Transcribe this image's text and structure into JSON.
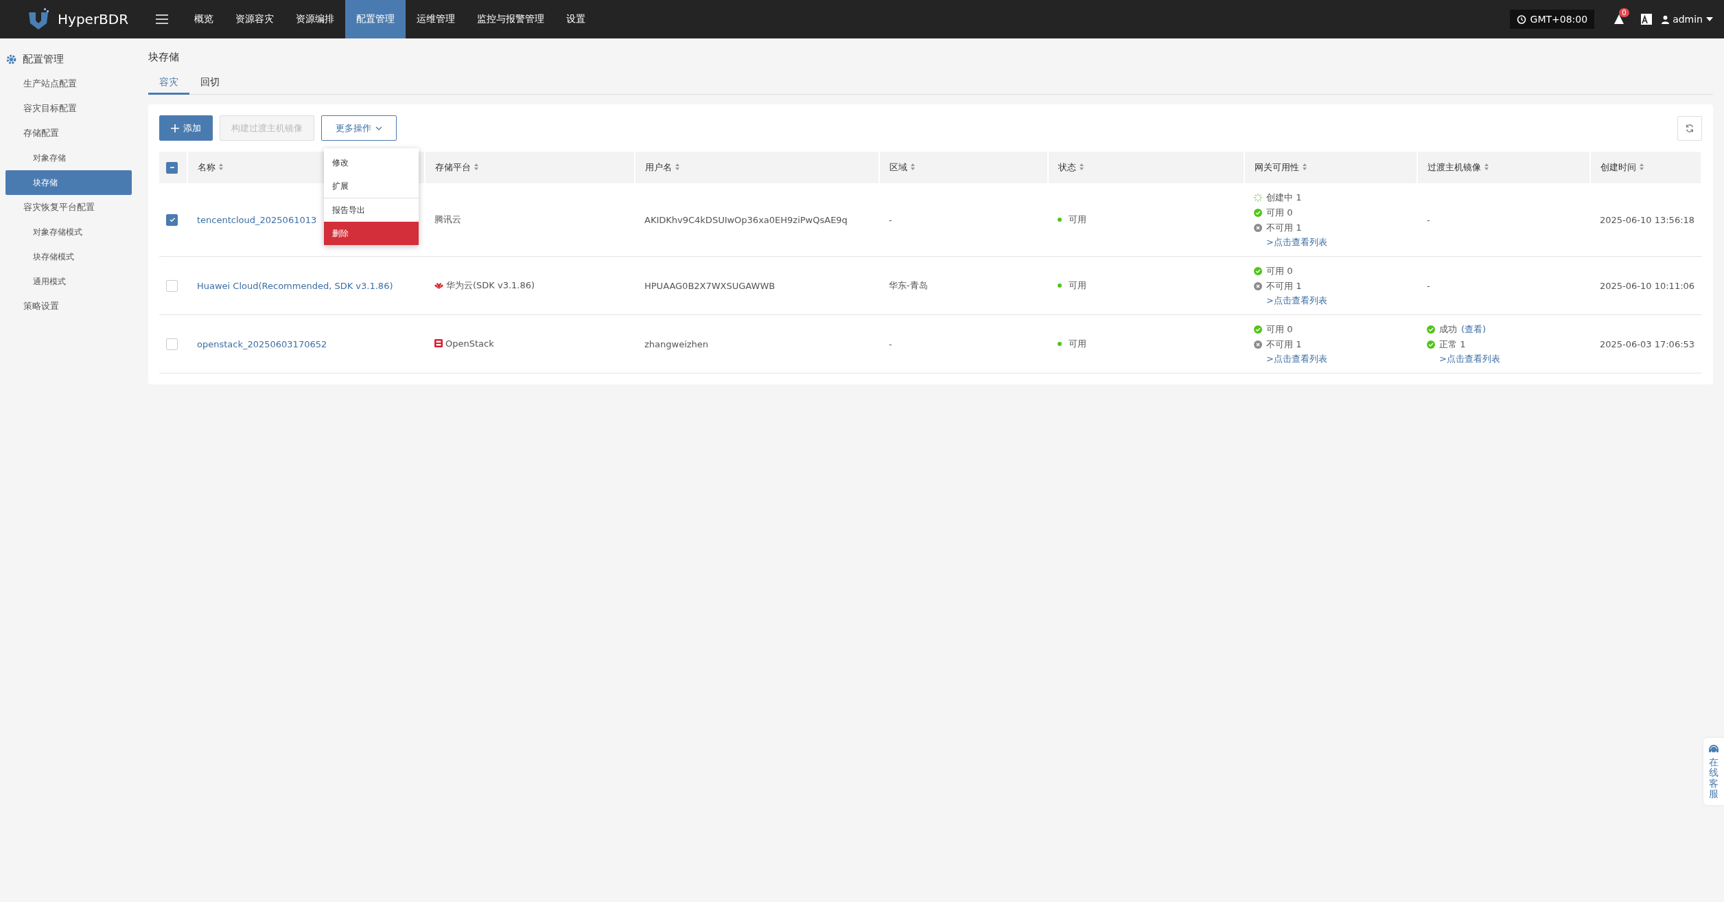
{
  "topbar": {
    "brand": "HyperBDR",
    "nav": [
      {
        "label": "概览",
        "selected": false
      },
      {
        "label": "资源容灾",
        "selected": false
      },
      {
        "label": "资源编排",
        "selected": false
      },
      {
        "label": "配置管理",
        "selected": true
      },
      {
        "label": "运维管理",
        "selected": false
      },
      {
        "label": "监控与报警管理",
        "selected": false
      },
      {
        "label": "设置",
        "selected": false
      }
    ],
    "timezone": "GMT+08:00",
    "alert_count": "0",
    "user": "admin"
  },
  "sidebar": {
    "title": "配置管理",
    "items": [
      {
        "label": "生产站点配置",
        "selected": false
      },
      {
        "label": "容灾目标配置",
        "selected": false
      },
      {
        "label": "存储配置",
        "selected": false,
        "children": [
          {
            "label": "对象存储",
            "selected": false
          },
          {
            "label": "块存储",
            "selected": true
          }
        ]
      },
      {
        "label": "容灾恢复平台配置",
        "selected": false,
        "children": [
          {
            "label": "对象存储模式",
            "selected": false
          },
          {
            "label": "块存储模式",
            "selected": false
          },
          {
            "label": "通用模式",
            "selected": false
          }
        ]
      },
      {
        "label": "策略设置",
        "selected": false
      }
    ]
  },
  "page": {
    "title": "块存储",
    "tabs": [
      {
        "label": "容灾",
        "selected": true
      },
      {
        "label": "回切",
        "selected": false
      }
    ]
  },
  "toolbar": {
    "add": "添加",
    "build": "构建过渡主机镜像",
    "build_disabled": true,
    "more": "更多操作",
    "menu": [
      {
        "label": "修改",
        "kind": "normal"
      },
      {
        "label": "扩展",
        "kind": "normal"
      },
      {
        "label": "报告导出",
        "kind": "normal"
      },
      {
        "label": "删除",
        "kind": "danger"
      }
    ]
  },
  "table": {
    "select_all_indeterminate": true,
    "columns": [
      "名称",
      "存储平台",
      "用户名",
      "区域",
      "状态",
      "网关可用性",
      "过渡主机镜像",
      "创建时间"
    ],
    "rows": [
      {
        "checked": true,
        "name": "tencentcloud_2025061013",
        "platform": "腾讯云",
        "kind": "tencent",
        "username": "AKIDKhv9C4kDSUIwOp36xa0EH9ziPwQsAE9q",
        "region": "-",
        "status": "可用",
        "gateway": [
          {
            "kind": "creating",
            "text": "创建中 1"
          },
          {
            "kind": "ok",
            "text": "可用 0"
          },
          {
            "kind": "fail",
            "text": "不可用 1"
          }
        ],
        "gateway_link": ">点击查看列表",
        "image": [],
        "image_text": "-",
        "created": "2025-06-10 13:56:18"
      },
      {
        "checked": false,
        "name": "Huawei Cloud(Recommended, SDK v3.1.86)",
        "platform": "华为云(SDK v3.1.86)",
        "kind": "huawei",
        "username": "HPUAAG0B2X7WXSUGAWWB",
        "region": "华东-青岛",
        "status": "可用",
        "gateway": [
          {
            "kind": "ok",
            "text": "可用 0"
          },
          {
            "kind": "fail",
            "text": "不可用 1"
          }
        ],
        "gateway_link": ">点击查看列表",
        "image": [],
        "image_text": "-",
        "created": "2025-06-10 10:11:06"
      },
      {
        "checked": false,
        "name": "openstack_20250603170652",
        "platform": "OpenStack",
        "kind": "openstack",
        "username": "zhangweizhen",
        "region": "-",
        "status": "可用",
        "gateway": [
          {
            "kind": "ok",
            "text": "可用 0"
          },
          {
            "kind": "fail",
            "text": "不可用 1"
          }
        ],
        "gateway_link": ">点击查看列表",
        "image": [
          {
            "kind": "ok",
            "text": "成功",
            "link": "(查看)"
          },
          {
            "kind": "ok",
            "text": "正常 1"
          }
        ],
        "image_link": ">点击查看列表",
        "created": "2025-06-03 17:06:53"
      }
    ]
  },
  "support": "在线客服"
}
